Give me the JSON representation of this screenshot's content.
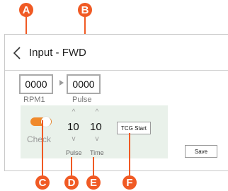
{
  "markers": {
    "a": "A",
    "b": "B",
    "c": "C",
    "d": "D",
    "e": "E",
    "f": "F"
  },
  "header": {
    "title": "Input - FWD",
    "back_icon": "chevron-left-icon"
  },
  "fields": {
    "rpm": {
      "value": "0000",
      "label": "RPM1"
    },
    "pulse": {
      "value": "0000",
      "label": "Pulse"
    }
  },
  "check": {
    "label": "Check",
    "enabled": true,
    "accent": "#f0892b"
  },
  "steppers": {
    "pulse": {
      "value": "10",
      "label": "Pulse"
    },
    "time": {
      "value": "10",
      "label": "Time"
    }
  },
  "buttons": {
    "tcg_start": "TCG Start",
    "save": "Save"
  },
  "colors": {
    "marker": "#f05a24",
    "group_bg": "#e9f1ea"
  }
}
